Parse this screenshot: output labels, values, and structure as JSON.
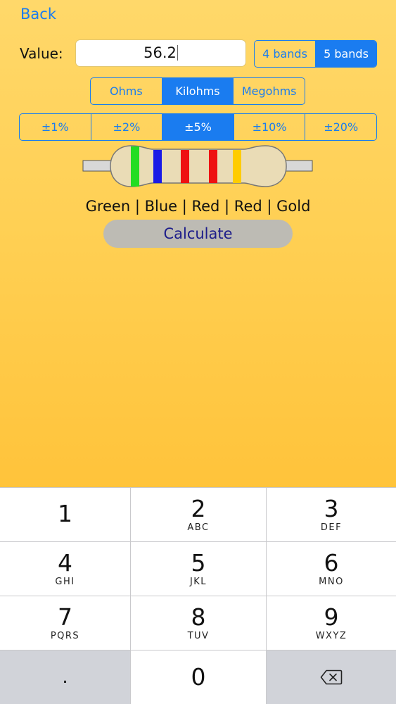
{
  "nav": {
    "back_label": "Back"
  },
  "value": {
    "label": "Value:",
    "current": "56.2"
  },
  "bands_toggle": {
    "options": [
      "4 bands",
      "5 bands"
    ],
    "selected": "5 bands"
  },
  "units": {
    "options": [
      "Ohms",
      "Kilohms",
      "Megohms"
    ],
    "selected": "Kilohms"
  },
  "tolerance": {
    "options": [
      "±1%",
      "±2%",
      "±5%",
      "±10%",
      "±20%"
    ],
    "selected": "±5%"
  },
  "resistor": {
    "band_names": [
      "Green",
      "Blue",
      "Red",
      "Red",
      "Gold"
    ],
    "band_colors": [
      "#22dd22",
      "#1a1ae6",
      "#ee1111",
      "#ee1111",
      "#ffcc00"
    ],
    "body_color": "#eadcb6",
    "lead_color": "#d8d8d8"
  },
  "result_text": "Green | Blue | Red | Red | Gold",
  "calculate_label": "Calculate",
  "keypad": {
    "keys": [
      {
        "num": "1",
        "letters": ""
      },
      {
        "num": "2",
        "letters": "ABC"
      },
      {
        "num": "3",
        "letters": "DEF"
      },
      {
        "num": "4",
        "letters": "GHI"
      },
      {
        "num": "5",
        "letters": "JKL"
      },
      {
        "num": "6",
        "letters": "MNO"
      },
      {
        "num": "7",
        "letters": "PQRS"
      },
      {
        "num": "8",
        "letters": "TUV"
      },
      {
        "num": "9",
        "letters": "WXYZ"
      }
    ],
    "decimal": ".",
    "zero": "0",
    "delete_icon": "backspace-icon"
  },
  "colors": {
    "accent": "#1a7cf0",
    "calc_text": "#1d1d8a",
    "calc_bg": "#bdbbb4"
  }
}
